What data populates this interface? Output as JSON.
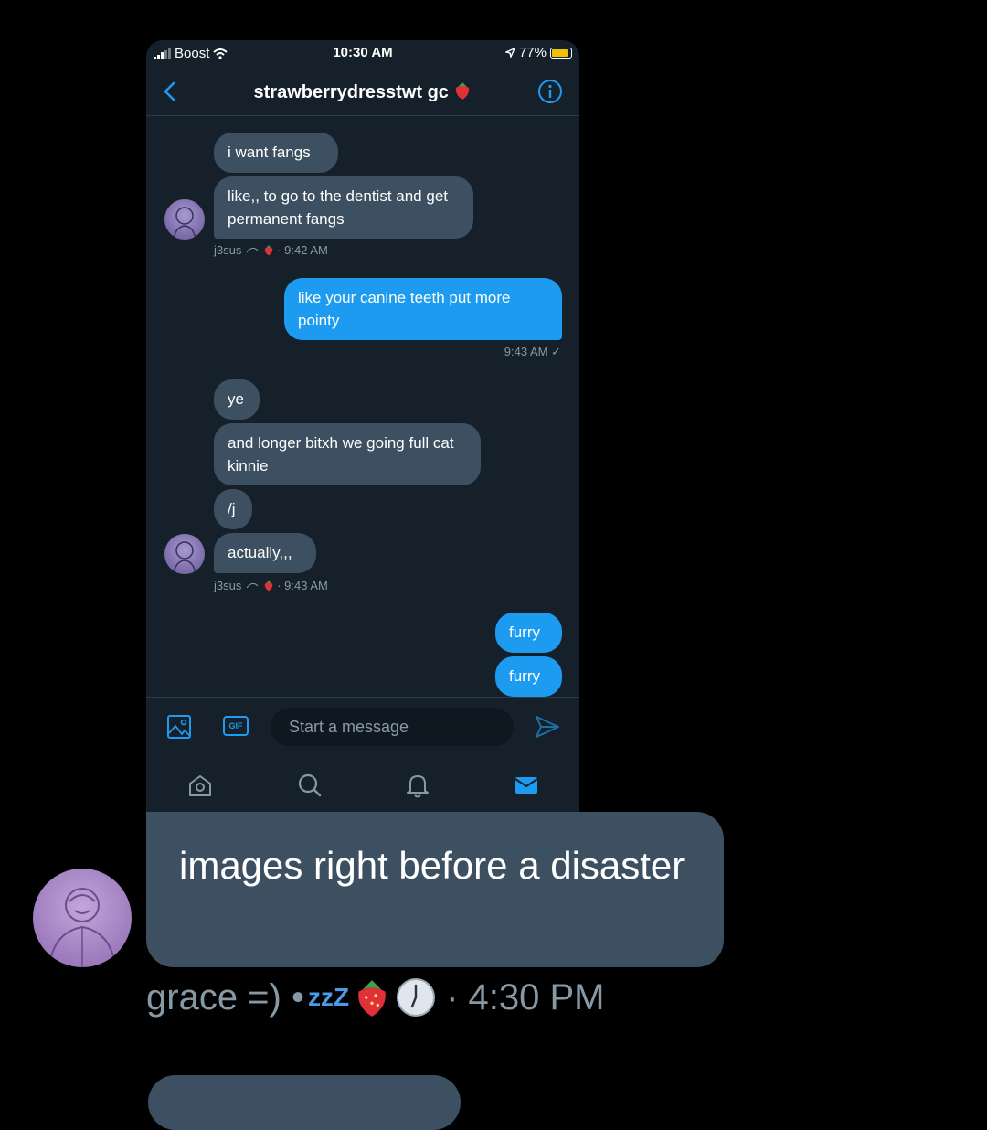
{
  "status_bar": {
    "carrier": "Boost",
    "time": "10:30 AM",
    "battery": "77%",
    "battery_level": 0.77
  },
  "conversation": {
    "title": "strawberrydresstwt gc",
    "title_emoji": "strawberry-icon"
  },
  "messages": [
    {
      "text": "i want fangs",
      "dir": "in"
    },
    {
      "text": "like,, to go to the dentist and get permanent fangs",
      "dir": "in"
    },
    {
      "meta": "j3sus",
      "time": "· 9:42 AM"
    },
    {
      "text": "like your canine teeth put more pointy",
      "dir": "out"
    },
    {
      "time": "9:43 AM ✓"
    },
    {
      "text": "ye",
      "dir": "in"
    },
    {
      "text": "and longer bitxh we going full cat kinnie",
      "dir": "in"
    },
    {
      "text": "/j",
      "dir": "in"
    },
    {
      "text": "actually,,,",
      "dir": "in"
    },
    {
      "meta": "j3sus",
      "time": "· 9:43 AM"
    },
    {
      "text": "furry",
      "dir": "out"
    },
    {
      "text": "furry",
      "dir": "out"
    }
  ],
  "composer": {
    "gif_label": "GIF",
    "placeholder": "Start a message"
  },
  "tabs": [
    "home-icon",
    "search-icon",
    "bell-icon",
    "mail-icon"
  ],
  "outer": {
    "message": "images right before a disaster",
    "author": "grace =) •",
    "status_icons": [
      "zzz-icon",
      "strawberry-icon",
      "clock-icon"
    ],
    "zzz": "zzZ",
    "time": "· 4:30 PM"
  },
  "colors": {
    "background": "#000000",
    "dm_background": "#15202b",
    "received_bubble": "#3d5061",
    "sent_bubble": "#1d9bf0",
    "meta_text": "#8899a6"
  }
}
